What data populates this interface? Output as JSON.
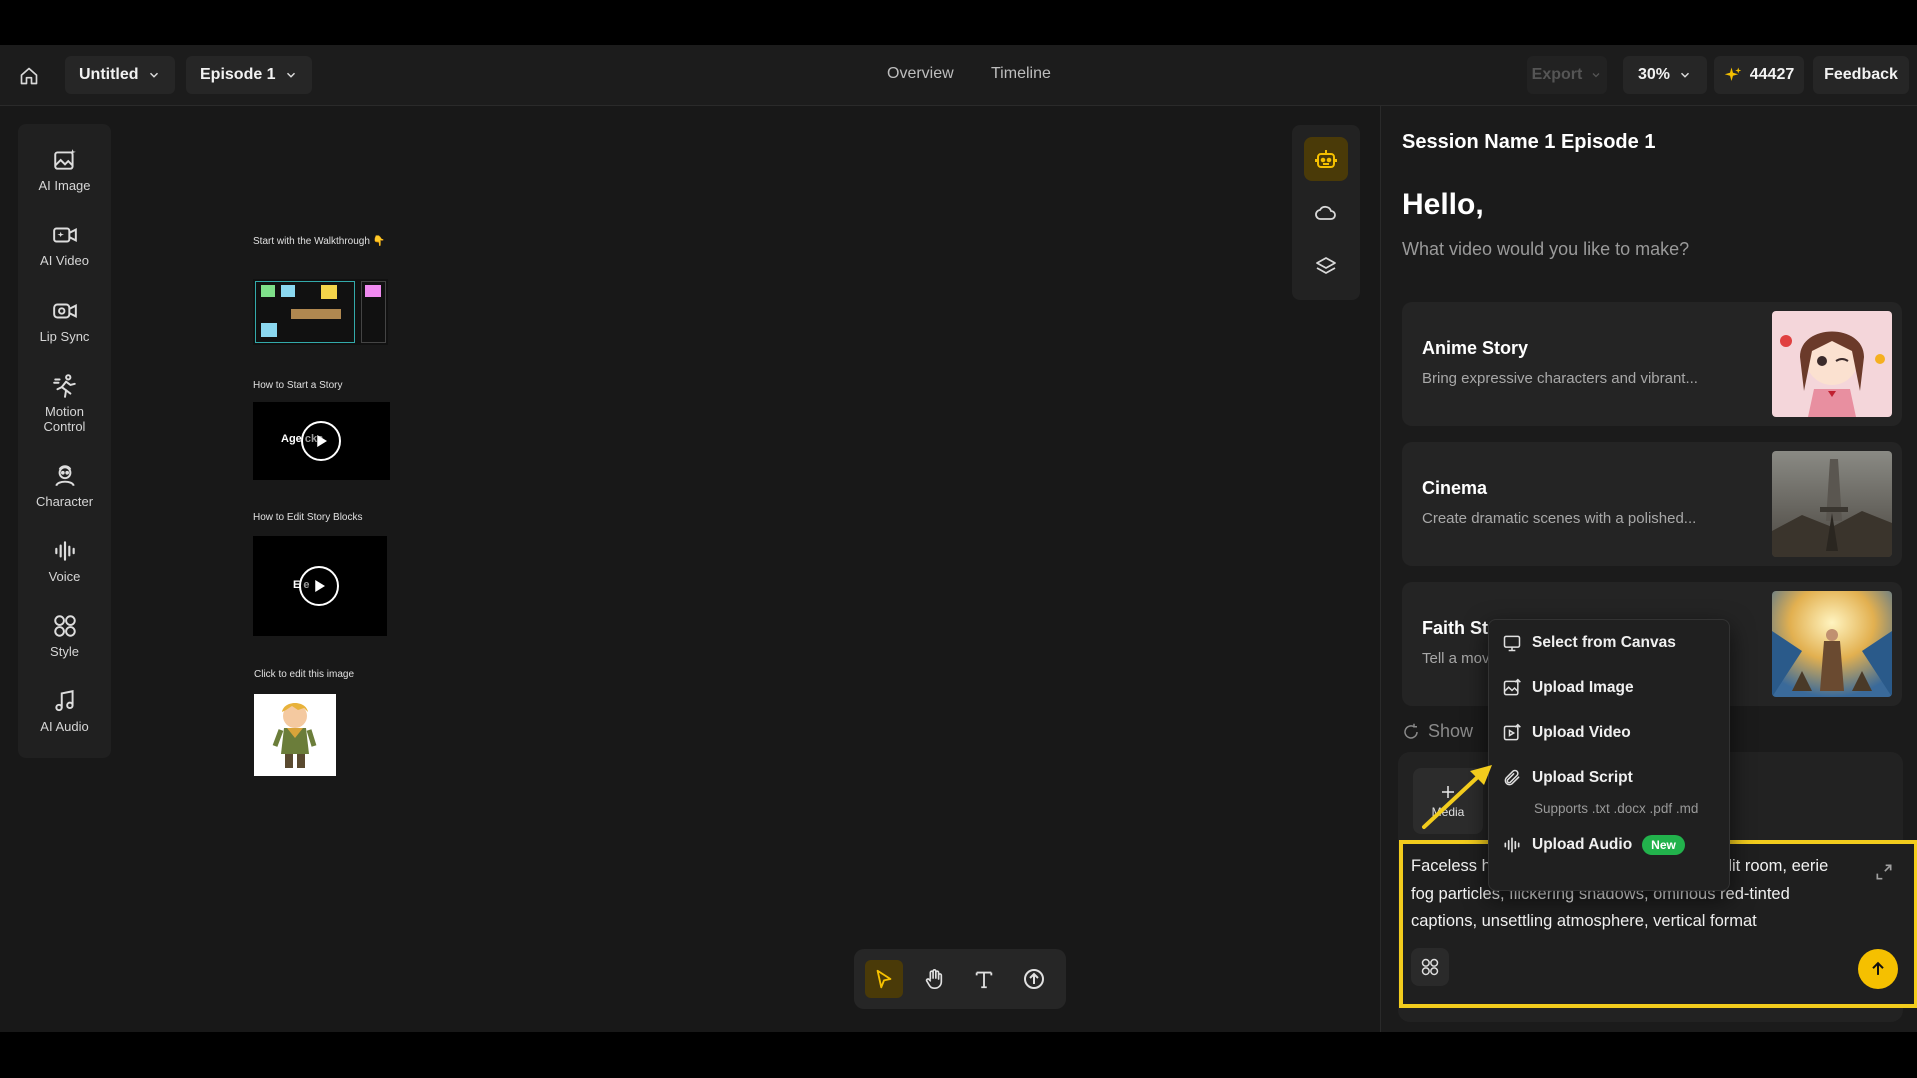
{
  "header": {
    "project_name": "Untitled",
    "episode": "Episode 1",
    "nav": [
      "Overview",
      "Timeline"
    ],
    "export_label": "Export",
    "zoom": "30%",
    "credits": "44427",
    "feedback_label": "Feedback"
  },
  "sidebar": {
    "items": [
      {
        "label": "AI Image",
        "icon": "image-sparkle-icon"
      },
      {
        "label": "AI Video",
        "icon": "video-sparkle-icon"
      },
      {
        "label": "Lip Sync",
        "icon": "lip-sync-icon"
      },
      {
        "label": "Motion Control",
        "icon": "motion-icon"
      },
      {
        "label": "Character",
        "icon": "character-icon"
      },
      {
        "label": "Voice",
        "icon": "voice-icon"
      },
      {
        "label": "Style",
        "icon": "style-icon"
      },
      {
        "label": "AI Audio",
        "icon": "music-icon"
      }
    ]
  },
  "canvas": {
    "walkthrough_label": "Start with the Walkthrough 👇",
    "video1_label": "How to Start a Story",
    "video1_overlay": "Age   cks",
    "video2_label": "How to Edit Story Blocks",
    "video2_overlay": "E       e",
    "image_label": "Click to edit this image"
  },
  "panel": {
    "session_title": "Session Name 1 Episode 1",
    "greeting": "Hello,",
    "question": "What video would you like to make?",
    "cards": [
      {
        "title": "Anime Story",
        "desc": "Bring expressive characters and vibrant..."
      },
      {
        "title": "Cinema",
        "desc": "Create dramatic scenes with a polished..."
      },
      {
        "title": "Faith Sto",
        "desc": "Tell a mov"
      }
    ],
    "show_more": "Show",
    "media_label": "Media",
    "prompt": "Faceless horror narration video, dim candlelit room, eerie fog particles, flickering shadows, ominous red-tinted captions, unsettling atmosphere, vertical format"
  },
  "menu": {
    "items": [
      "Select from Canvas",
      "Upload Image",
      "Upload Video",
      "Upload Script",
      "Upload Audio"
    ],
    "script_hint": "Supports .txt .docx .pdf .md",
    "new_badge": "New"
  },
  "colors": {
    "accent": "#f5c000",
    "highlight_border": "#f2cc1d",
    "badge_green": "#22b24c"
  }
}
